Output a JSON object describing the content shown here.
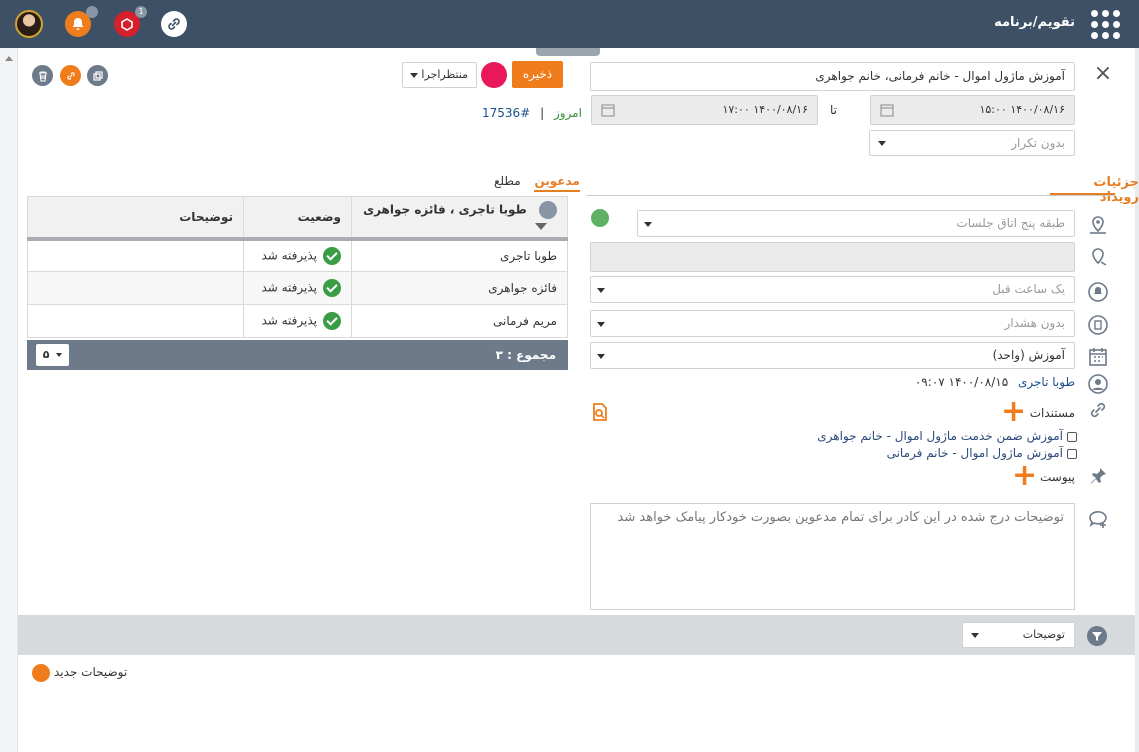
{
  "app": {
    "title": "تقویم/برنامه"
  },
  "header": {
    "bell_badge": "",
    "alarm_badge": "1"
  },
  "event": {
    "title_value": "آموزش ماژول اموال - خانم فرمانی، خانم جواهری",
    "start": "۱۴۰۰/۰۸/۱۶ ۱۵:۰۰",
    "end": "۱۴۰۰/۰۸/۱۶ ۱۷:۰۰",
    "to_label": "تا",
    "repeat": "بدون تکرار",
    "details_title": "جزئیات رویداد",
    "location_placeholder": "طبقه پنج اتاق جلسات",
    "reminder": "یک ساعت قبل",
    "warning": "بدون هشدار",
    "category": "آموزش (واحد)",
    "creator": "طوبا تاجری",
    "created_at": "۱۴۰۰/۰۸/۱۵ ۰۹:۰۷",
    "documents_label": "مستندات",
    "documents": [
      "آموزش ضمن خدمت ماژول اموال - خانم جواهری",
      "آموزش ماژول اموال - خانم فرمانی"
    ],
    "attachment_label": "پیوست",
    "description_placeholder": "توضیحات درج شده در این کادر برای تمام مدعوین بصورت خودکار پیامک خواهد شد"
  },
  "toolbar": {
    "save_label": "ذخیره",
    "status": "منتظراجرا",
    "today_label": "امروز",
    "separator": "|",
    "event_id": "#17536"
  },
  "invitees": {
    "tab_invitees": "مدعوین",
    "tab_informed": "مطلع",
    "columns": [
      "طوبا تاجری ، فائزه جواهری",
      "وضعیت",
      "توضیحات"
    ],
    "rows": [
      {
        "name": "طوبا تاجری",
        "status": "پذیرفته شد",
        "note": ""
      },
      {
        "name": "فائزه جواهری",
        "status": "پذیرفته شد",
        "note": ""
      },
      {
        "name": "مریم فرمانی",
        "status": "پذیرفته شد",
        "note": ""
      }
    ],
    "total_label": "مجموع : ۳",
    "page_size": "۵"
  },
  "notes": {
    "filter_value": "توضیحات",
    "new_note_label": "توضیحات جدید"
  }
}
